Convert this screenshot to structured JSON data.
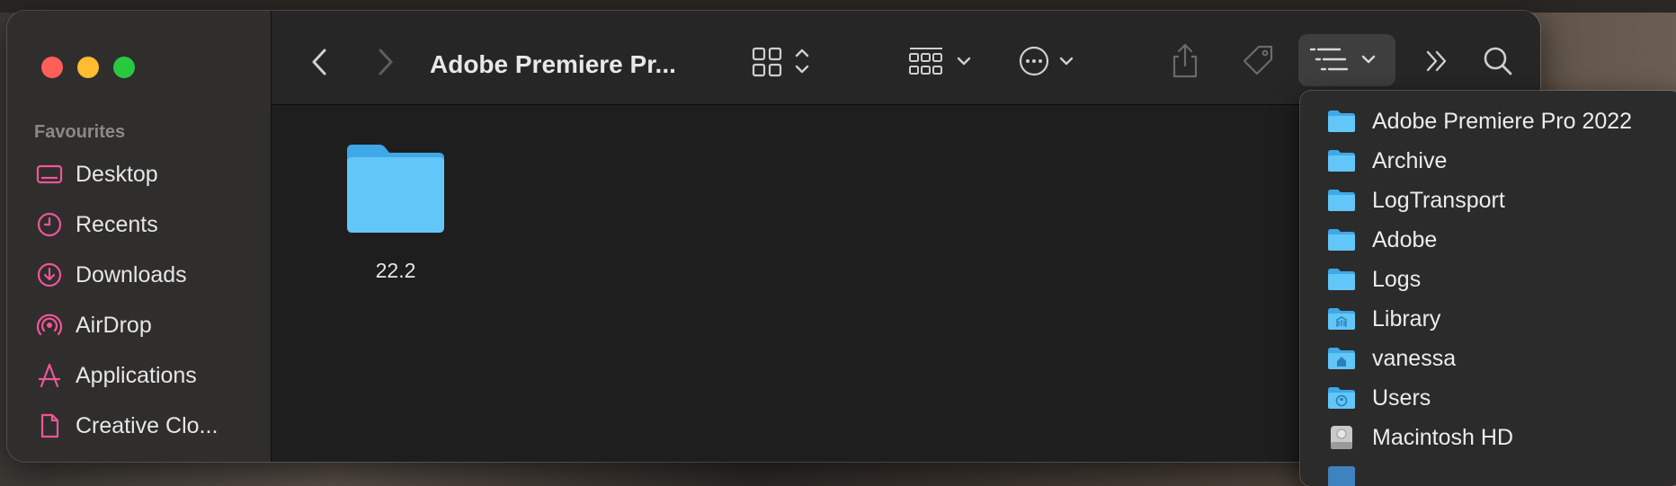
{
  "window": {
    "title": "Adobe Premiere Pr..."
  },
  "sidebar": {
    "section_title": "Favourites",
    "items": [
      {
        "label": "Desktop",
        "icon": "desktop-icon"
      },
      {
        "label": "Recents",
        "icon": "clock-icon"
      },
      {
        "label": "Downloads",
        "icon": "download-icon"
      },
      {
        "label": "AirDrop",
        "icon": "airdrop-icon"
      },
      {
        "label": "Applications",
        "icon": "applications-icon"
      },
      {
        "label": "Creative Clo...",
        "icon": "document-icon"
      }
    ]
  },
  "content": {
    "items": [
      {
        "name": "22.2",
        "icon": "folder-icon"
      }
    ]
  },
  "path_menu": {
    "items": [
      {
        "label": "Adobe Premiere Pro 2022",
        "icon": "folder-icon"
      },
      {
        "label": "Archive",
        "icon": "folder-icon"
      },
      {
        "label": "LogTransport",
        "icon": "folder-icon"
      },
      {
        "label": "Adobe",
        "icon": "folder-icon"
      },
      {
        "label": "Logs",
        "icon": "folder-icon"
      },
      {
        "label": "Library",
        "icon": "library-folder-icon"
      },
      {
        "label": "vanessa",
        "icon": "home-folder-icon"
      },
      {
        "label": "Users",
        "icon": "users-folder-icon"
      },
      {
        "label": "Macintosh HD",
        "icon": "hard-drive-icon"
      }
    ]
  },
  "colors": {
    "accent_pink": "#f0559a",
    "folder_blue": "#5ac8fa",
    "traffic_red": "#ff5f57",
    "traffic_yellow": "#febc2e",
    "traffic_green": "#28c840"
  }
}
